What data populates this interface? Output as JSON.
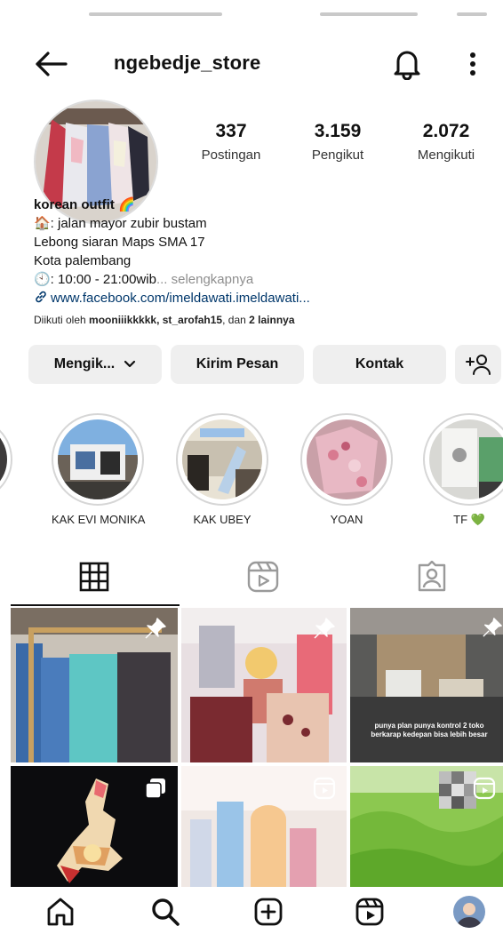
{
  "header": {
    "username": "ngebedje_store"
  },
  "stats": [
    {
      "value": "337",
      "label": "Postingan"
    },
    {
      "value": "3.159",
      "label": "Pengikut"
    },
    {
      "value": "2.072",
      "label": "Mengikuti"
    }
  ],
  "bio": {
    "name": "korean outfit 🌈",
    "address_line": "🏠: jalan mayor zubir bustam",
    "line2": "Lebong siaran Maps SMA 17",
    "line3": "Kota palembang",
    "hours": "🕙: 10:00 - 21:00wib",
    "more": "... selengkapnya",
    "link": "www.facebook.com/imeldawati.imeldawati...",
    "followed_prefix": "Diikuti oleh ",
    "followed_names": "mooniiikkkkk, st_arofah15",
    "followed_mid": ", dan ",
    "followed_others": "2 lainnya"
  },
  "actions": {
    "following": "Mengik...",
    "message": "Kirim Pesan",
    "contact": "Kontak"
  },
  "highlights": [
    {
      "label": "KAK EVI MONIKA"
    },
    {
      "label": "KAK UBEY"
    },
    {
      "label": "YOAN"
    },
    {
      "label": "TF 💚"
    }
  ],
  "posts": {
    "overlay_text": "punya plan punya kontrol 2 toko berkarap kedepan bisa lebih besar"
  },
  "icons": {
    "back": "arrow-left-icon",
    "notify": "bell-icon",
    "more": "more-vertical-icon",
    "grid": "grid-icon",
    "reels": "reels-icon",
    "tagged": "tagged-icon",
    "home": "home-icon",
    "search": "search-icon",
    "create": "plus-square-icon",
    "reels_nav": "reels-icon",
    "profile": "avatar"
  },
  "colors": {
    "button_bg": "#efefef",
    "link": "#00376b",
    "muted": "#8e8e8e"
  }
}
